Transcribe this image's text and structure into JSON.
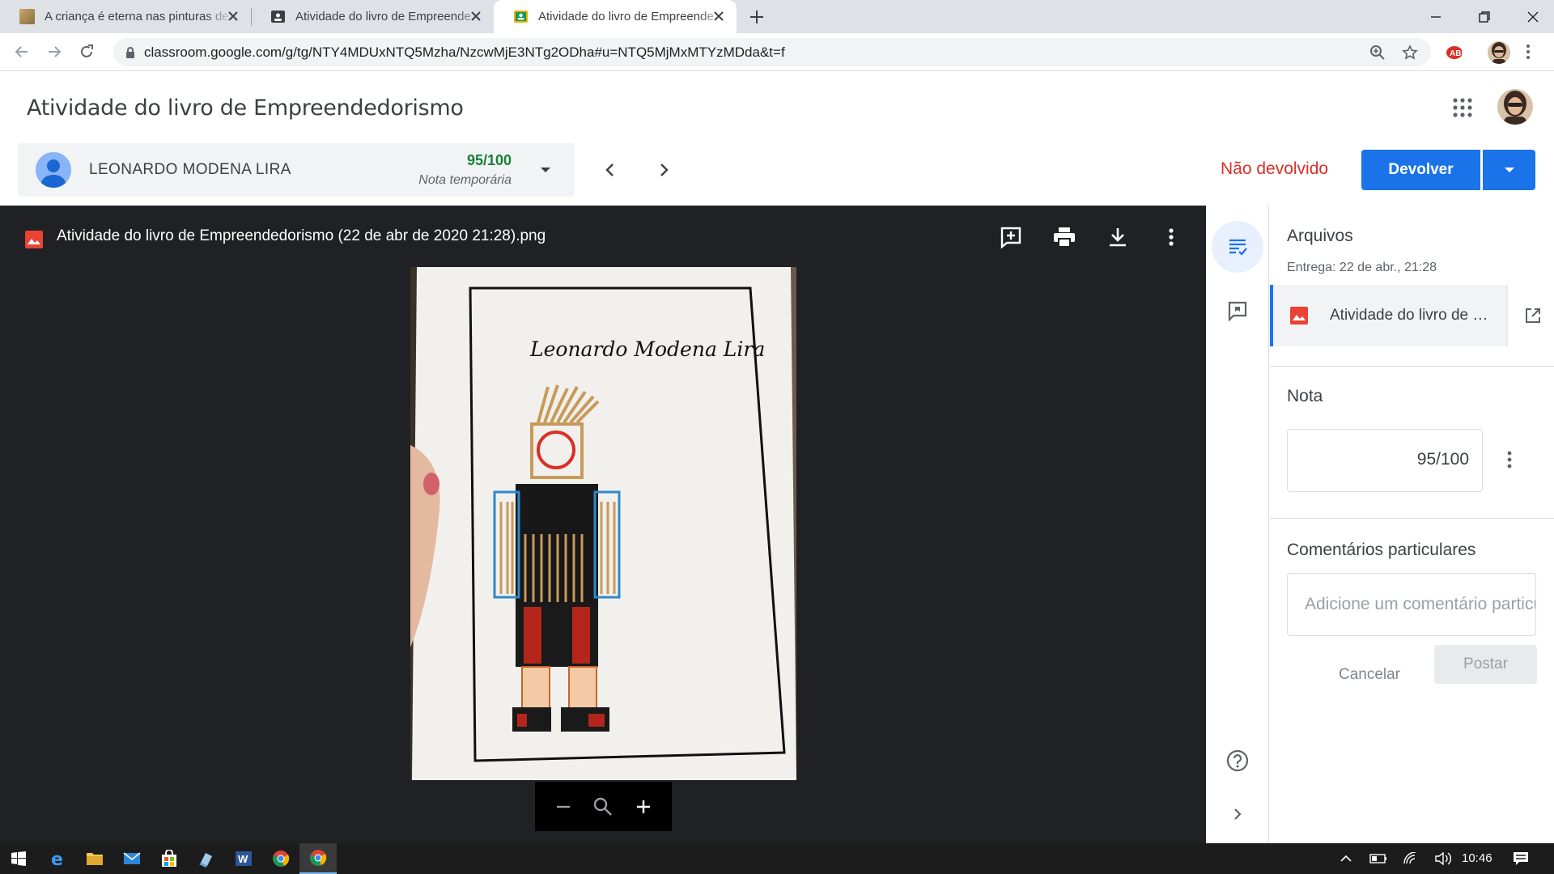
{
  "browser": {
    "tabs": [
      {
        "title": "A criança é eterna nas pinturas de",
        "active": false,
        "favicon": "painting-favicon"
      },
      {
        "title": "Atividade do livro de Empreende",
        "active": false,
        "favicon": "classroom-favicon-dark"
      },
      {
        "title": "Atividade do livro de Empreende",
        "active": true,
        "favicon": "classroom-favicon"
      }
    ],
    "url": "classroom.google.com/g/tg/NTY4MDUxNTQ5Mzha/NzcwMjE3NTg2ODha#u=NTQ5MjMxMTYzMDda&t=f"
  },
  "header": {
    "title": "Atividade do livro de Empreendedorismo"
  },
  "student": {
    "name": "LEONARDO MODENA LIRA",
    "grade": "95/100",
    "grade_note": "Nota temporária"
  },
  "submission": {
    "status": "Não devolvido",
    "return_label": "Devolver"
  },
  "viewer": {
    "file_title": "Atividade do livro de Empreendedorismo (22 de abr de 2020 21:28).png",
    "drawing_name": "Leonardo Modena Lira"
  },
  "panel": {
    "files_heading": "Arquivos",
    "delivered": "Entrega: 22 de abr., 21:28",
    "file_name": "Atividade do livro de Empreendedorismo",
    "grade_heading": "Nota",
    "grade_value": "95/100",
    "comments_heading": "Comentários particulares",
    "comment_placeholder": "Adicione um comentário particular...",
    "cancel_label": "Cancelar",
    "post_label": "Postar"
  },
  "taskbar": {
    "time": "10:46"
  },
  "colors": {
    "accent": "#1a73e8",
    "grade_green": "#188038",
    "status_red": "#d93025",
    "viewer_bg": "#202124"
  }
}
